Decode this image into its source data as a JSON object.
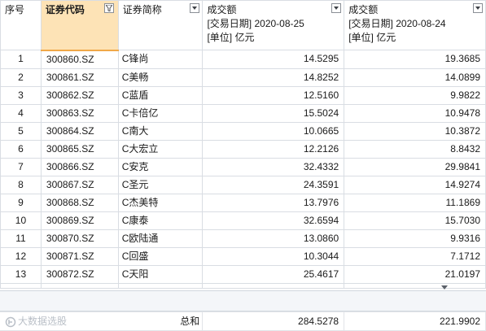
{
  "columns": {
    "seq": "序号",
    "code": "证券代码",
    "name": "证券简称",
    "turnover_25": {
      "title": "成交额",
      "date": "[交易日期] 2020-08-25",
      "unit": "[单位] 亿元"
    },
    "turnover_24": {
      "title": "成交额",
      "date": "[交易日期] 2020-08-24",
      "unit": "[单位] 亿元"
    }
  },
  "rows": [
    {
      "seq": "1",
      "code": "300860.SZ",
      "name": "C锋尚",
      "v25": "14.5295",
      "v24": "19.3685"
    },
    {
      "seq": "2",
      "code": "300861.SZ",
      "name": "C美畅",
      "v25": "14.8252",
      "v24": "14.0899"
    },
    {
      "seq": "3",
      "code": "300862.SZ",
      "name": "C蓝盾",
      "v25": "12.5160",
      "v24": "9.9822"
    },
    {
      "seq": "4",
      "code": "300863.SZ",
      "name": "C卡倍亿",
      "v25": "15.5024",
      "v24": "10.9478"
    },
    {
      "seq": "5",
      "code": "300864.SZ",
      "name": "C南大",
      "v25": "10.0665",
      "v24": "10.3872"
    },
    {
      "seq": "6",
      "code": "300865.SZ",
      "name": "C大宏立",
      "v25": "12.2126",
      "v24": "8.8432"
    },
    {
      "seq": "7",
      "code": "300866.SZ",
      "name": "C安克",
      "v25": "32.4332",
      "v24": "29.9841"
    },
    {
      "seq": "8",
      "code": "300867.SZ",
      "name": "C圣元",
      "v25": "24.3591",
      "v24": "14.9274"
    },
    {
      "seq": "9",
      "code": "300868.SZ",
      "name": "C杰美特",
      "v25": "13.7976",
      "v24": "11.1869"
    },
    {
      "seq": "10",
      "code": "300869.SZ",
      "name": "C康泰",
      "v25": "32.6594",
      "v24": "15.7030"
    },
    {
      "seq": "11",
      "code": "300870.SZ",
      "name": "C欧陆通",
      "v25": "13.0860",
      "v24": "9.9316"
    },
    {
      "seq": "12",
      "code": "300871.SZ",
      "name": "C回盛",
      "v25": "10.3044",
      "v24": "7.1712"
    },
    {
      "seq": "13",
      "code": "300872.SZ",
      "name": "C天阳",
      "v25": "25.4617",
      "v24": "21.0197"
    }
  ],
  "footer": {
    "total_label": "总和",
    "total_25": "284.5278",
    "total_24": "221.9902"
  },
  "logo_text": "大数据选股",
  "colors": {
    "selected_header": "#fde3b6",
    "grid_line": "#d9dde3"
  }
}
